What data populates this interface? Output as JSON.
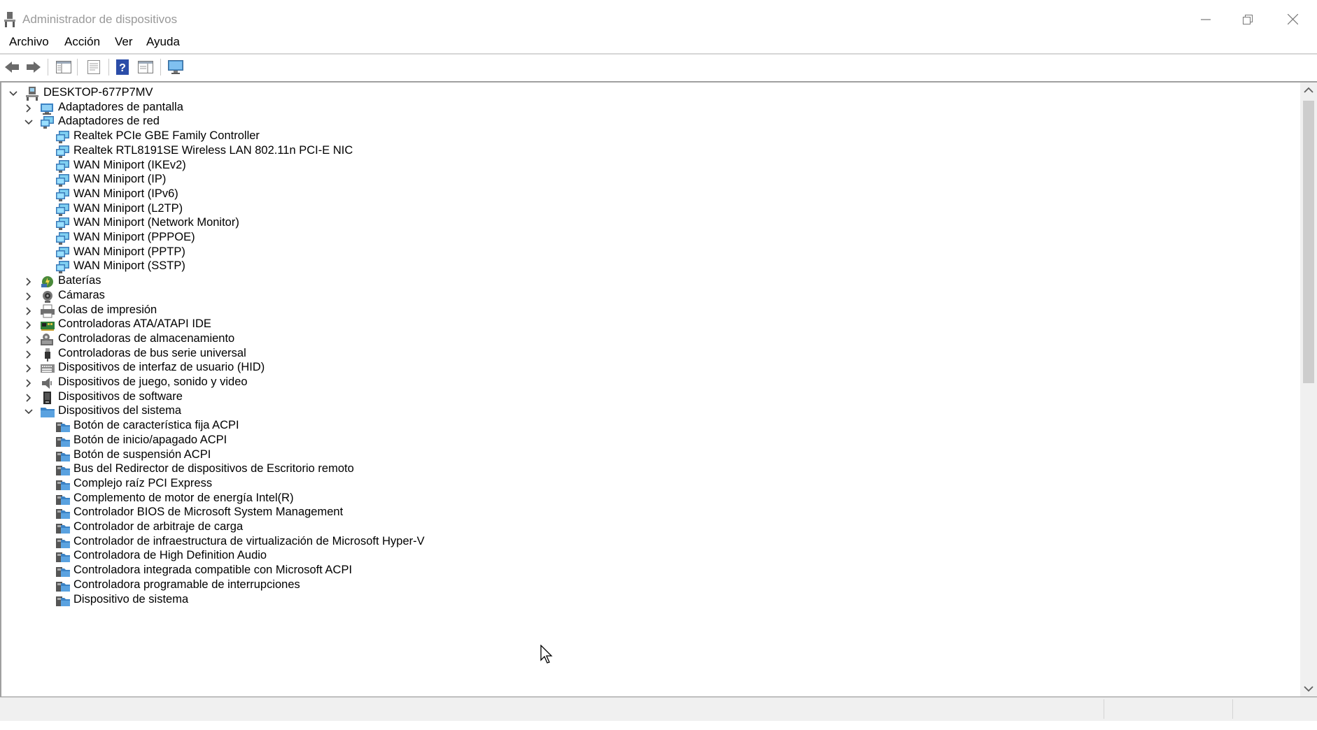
{
  "window": {
    "title": "Administrador de dispositivos"
  },
  "menu": {
    "items": [
      "Archivo",
      "Acción",
      "Ver",
      "Ayuda"
    ]
  },
  "toolbar": {
    "buttons": [
      "back-arrow-icon",
      "forward-arrow-icon",
      "show-hide-console-tree-icon",
      "properties-icon",
      "help-icon",
      "action-pane-icon",
      "monitor-icon"
    ]
  },
  "tree": {
    "root": "DESKTOP-677P7MV",
    "rows": [
      {
        "label": "Adaptadores de pantalla",
        "level": 1,
        "state": "collapsed",
        "icon": "display-adapter-icon"
      },
      {
        "label": "Adaptadores de red",
        "level": 1,
        "state": "expanded",
        "icon": "network-adapter-icon"
      },
      {
        "label": "Realtek PCIe GBE Family Controller",
        "level": 2,
        "state": "leaf",
        "icon": "network-adapter-icon"
      },
      {
        "label": "Realtek RTL8191SE Wireless LAN 802.11n PCI-E NIC",
        "level": 2,
        "state": "leaf",
        "icon": "network-adapter-icon"
      },
      {
        "label": "WAN Miniport (IKEv2)",
        "level": 2,
        "state": "leaf",
        "icon": "network-adapter-icon"
      },
      {
        "label": "WAN Miniport (IP)",
        "level": 2,
        "state": "leaf",
        "icon": "network-adapter-icon"
      },
      {
        "label": "WAN Miniport (IPv6)",
        "level": 2,
        "state": "leaf",
        "icon": "network-adapter-icon"
      },
      {
        "label": "WAN Miniport (L2TP)",
        "level": 2,
        "state": "leaf",
        "icon": "network-adapter-icon"
      },
      {
        "label": "WAN Miniport (Network Monitor)",
        "level": 2,
        "state": "leaf",
        "icon": "network-adapter-icon"
      },
      {
        "label": "WAN Miniport (PPPOE)",
        "level": 2,
        "state": "leaf",
        "icon": "network-adapter-icon"
      },
      {
        "label": "WAN Miniport (PPTP)",
        "level": 2,
        "state": "leaf",
        "icon": "network-adapter-icon"
      },
      {
        "label": "WAN Miniport (SSTP)",
        "level": 2,
        "state": "leaf",
        "icon": "network-adapter-icon"
      },
      {
        "label": "Baterías",
        "level": 1,
        "state": "collapsed",
        "icon": "battery-icon"
      },
      {
        "label": "Cámaras",
        "level": 1,
        "state": "collapsed",
        "icon": "camera-icon"
      },
      {
        "label": "Colas de impresión",
        "level": 1,
        "state": "collapsed",
        "icon": "printer-icon"
      },
      {
        "label": "Controladoras ATA/ATAPI IDE",
        "level": 1,
        "state": "collapsed",
        "icon": "ide-controller-icon"
      },
      {
        "label": "Controladoras de almacenamiento",
        "level": 1,
        "state": "collapsed",
        "icon": "storage-controller-icon"
      },
      {
        "label": "Controladoras de bus serie universal",
        "level": 1,
        "state": "collapsed",
        "icon": "usb-icon"
      },
      {
        "label": "Dispositivos de interfaz de usuario (HID)",
        "level": 1,
        "state": "collapsed",
        "icon": "hid-icon"
      },
      {
        "label": "Dispositivos de juego, sonido y video",
        "level": 1,
        "state": "collapsed",
        "icon": "speaker-icon"
      },
      {
        "label": "Dispositivos de software",
        "level": 1,
        "state": "collapsed",
        "icon": "software-device-icon"
      },
      {
        "label": "Dispositivos del sistema",
        "level": 1,
        "state": "expanded",
        "icon": "system-device-folder-icon"
      },
      {
        "label": "Botón de característica fija ACPI",
        "level": 2,
        "state": "leaf",
        "icon": "system-device-icon"
      },
      {
        "label": "Botón de inicio/apagado ACPI",
        "level": 2,
        "state": "leaf",
        "icon": "system-device-icon"
      },
      {
        "label": "Botón de suspensión ACPI",
        "level": 2,
        "state": "leaf",
        "icon": "system-device-icon"
      },
      {
        "label": "Bus del Redirector de dispositivos de Escritorio remoto",
        "level": 2,
        "state": "leaf",
        "icon": "system-device-icon"
      },
      {
        "label": "Complejo raíz PCI Express",
        "level": 2,
        "state": "leaf",
        "icon": "system-device-icon"
      },
      {
        "label": "Complemento de motor de energía Intel(R)",
        "level": 2,
        "state": "leaf",
        "icon": "system-device-icon"
      },
      {
        "label": "Controlador BIOS de Microsoft System Management",
        "level": 2,
        "state": "leaf",
        "icon": "system-device-icon"
      },
      {
        "label": "Controlador de arbitraje de carga",
        "level": 2,
        "state": "leaf",
        "icon": "system-device-icon"
      },
      {
        "label": "Controlador de infraestructura de virtualización de Microsoft Hyper-V",
        "level": 2,
        "state": "leaf",
        "icon": "system-device-icon"
      },
      {
        "label": "Controladora de High Definition Audio",
        "level": 2,
        "state": "leaf",
        "icon": "system-device-icon"
      },
      {
        "label": "Controladora integrada compatible con Microsoft ACPI",
        "level": 2,
        "state": "leaf",
        "icon": "system-device-icon"
      },
      {
        "label": "Controladora programable de interrupciones",
        "level": 2,
        "state": "leaf",
        "icon": "system-device-icon"
      },
      {
        "label": "Dispositivo de sistema",
        "level": 2,
        "state": "leaf",
        "icon": "system-device-icon"
      }
    ]
  },
  "scrollbar": {
    "vertical_position": 0.0,
    "visible_fraction": 0.46
  },
  "colors": {
    "tree_text": "#000000",
    "title_text": "#9a9a9a",
    "chevron": "#404040",
    "scroll_thumb": "#cdcdcd"
  }
}
